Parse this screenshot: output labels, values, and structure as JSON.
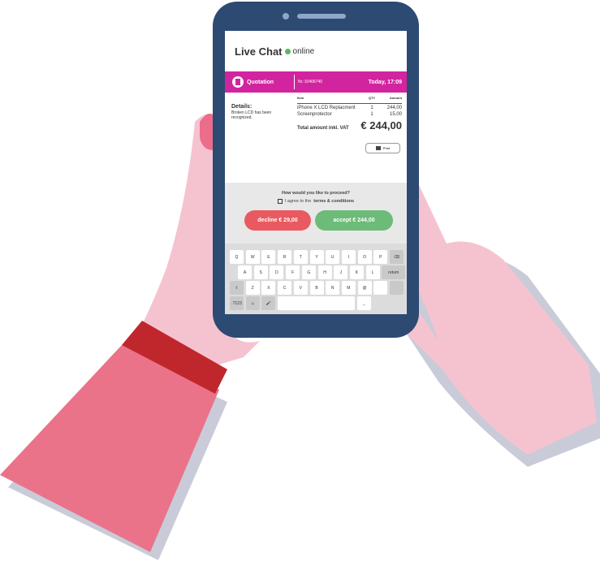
{
  "chat": {
    "title": "Live Chat",
    "status": "online"
  },
  "quotation": {
    "label": "Quotation",
    "number": "Nr.:10406740",
    "date": "Today, 17:09"
  },
  "details": {
    "heading": "Details:",
    "text": "Broken LCD has been recognized."
  },
  "table": {
    "headers": [
      "Item",
      "QTY",
      "Amount"
    ],
    "rows": [
      [
        "iPhone X LCD Replacment",
        "1",
        "244,00"
      ],
      [
        "Screenprotector",
        "1",
        "15,00"
      ]
    ],
    "total_label": "Total amount inkl. VAT",
    "total_value": "€ 244,00"
  },
  "print_label": "Print",
  "proceed": {
    "question": "How would you like to proceed?",
    "agree_prefix": "I agree to the",
    "agree_link": "terms & conditions",
    "decline": "decline € 29,00",
    "accept": "accept € 244,00"
  },
  "keyboard": {
    "rows": [
      [
        "Q",
        "W",
        "E",
        "R",
        "T",
        "Y",
        "U",
        "I",
        "O",
        "P",
        "⌫"
      ],
      [
        "A",
        "S",
        "D",
        "F",
        "G",
        "H",
        "J",
        "K",
        "L",
        "return"
      ],
      [
        "⇧",
        "Z",
        "X",
        "C",
        "V",
        "B",
        "N",
        "M",
        "@",
        "",
        ""
      ],
      [
        ".?123",
        "☺",
        "🎤",
        "",
        "_"
      ]
    ]
  },
  "colors": {
    "phone": "#2d4a72",
    "accent": "#d3249f",
    "decline": "#e85a5f",
    "accept": "#6cbb78",
    "skin": "#f5c3cf",
    "sleeve": "#ea7389",
    "cuff": "#c0272d"
  }
}
